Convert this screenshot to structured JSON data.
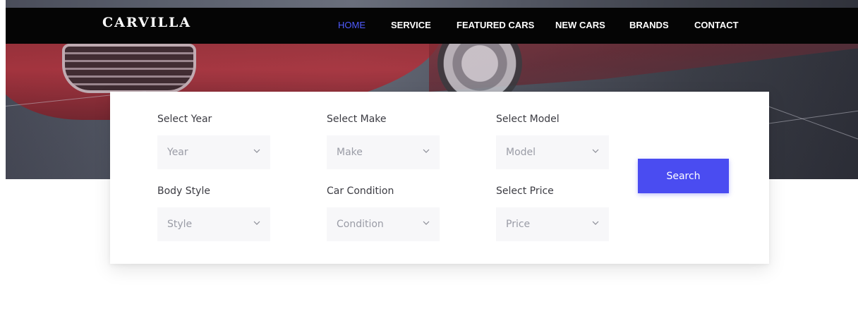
{
  "brand": {
    "name": "CARVILLA"
  },
  "nav": {
    "items": [
      {
        "label": "HOME"
      },
      {
        "label": "SERVICE"
      },
      {
        "label": "FEATURED CARS"
      },
      {
        "label": "NEW CARS"
      },
      {
        "label": "BRANDS"
      },
      {
        "label": "CONTACT"
      }
    ],
    "active_index": 0
  },
  "search": {
    "fields": [
      {
        "label": "Select Year",
        "value": "Year"
      },
      {
        "label": "Select Make",
        "value": "Make"
      },
      {
        "label": "Select Model",
        "value": "Model"
      },
      {
        "label": "Body Style",
        "value": "Style"
      },
      {
        "label": "Car Condition",
        "value": "Condition"
      },
      {
        "label": "Select Price",
        "value": "Price"
      }
    ],
    "button_label": "Search"
  },
  "colors": {
    "accent": "#4a4cf1",
    "nav_active": "#4f5bff",
    "nav_background": "#050505"
  }
}
